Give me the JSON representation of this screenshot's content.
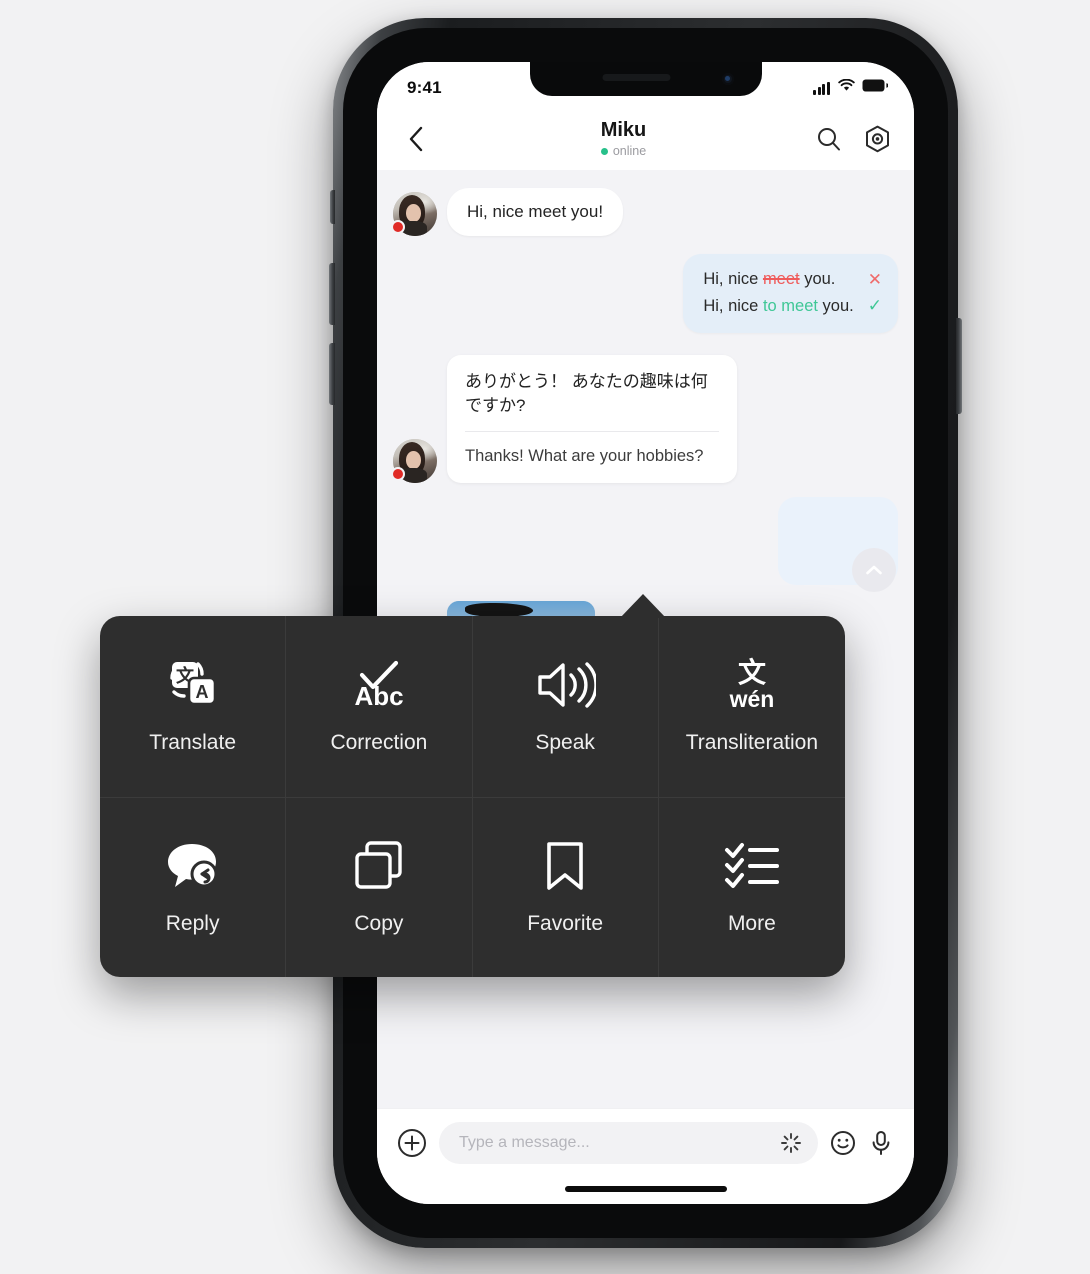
{
  "status_bar": {
    "time": "9:41",
    "signal_icon": "cellular-bars-icon",
    "wifi_icon": "wifi-icon",
    "battery_icon": "battery-full-icon"
  },
  "nav": {
    "back_icon": "chevron-left-icon",
    "title": "Miku",
    "status": "online",
    "status_color": "#27c08a",
    "search_icon": "search-icon",
    "settings_icon": "hexagon-settings-icon"
  },
  "chat": {
    "messages": [
      {
        "id": "msg-greeting-incoming",
        "type": "incoming-text",
        "avatar": "contact-avatar",
        "text": "Hi, nice meet you!"
      },
      {
        "id": "msg-correction-outgoing",
        "type": "outgoing-correction",
        "original_prefix": "Hi, nice ",
        "original_strike": "meet",
        "original_suffix": " you.",
        "corrected_prefix": "Hi, nice ",
        "corrected_added": "to meet",
        "corrected_suffix": " you.",
        "reject_icon": "close-x-icon",
        "accept_icon": "check-icon",
        "strike_color": "#ef5b5b",
        "added_color": "#3fc796",
        "bubble_color": "#e4eef8"
      },
      {
        "id": "msg-japanese-incoming",
        "type": "incoming-translated",
        "avatar": "contact-avatar",
        "source_text": "ありがとう！ あなたの趣味は何ですか?",
        "translated_text": "Thanks! What are your hobbies?"
      },
      {
        "id": "msg-outgoing-hidden",
        "type": "outgoing-partial",
        "text": ""
      },
      {
        "id": "msg-photo-incoming",
        "type": "incoming-photo",
        "avatar": "contact-avatar",
        "photo_alt": "landscape-photo"
      }
    ],
    "scroll_top_icon": "chevron-up-icon"
  },
  "input_bar": {
    "add_icon": "plus-circle-icon",
    "placeholder": "Type a message...",
    "magic_icon": "sparkle-ai-icon",
    "emoji_icon": "smiley-face-icon",
    "mic_icon": "microphone-icon"
  },
  "context_menu": {
    "background": "#2e2e2e",
    "items": [
      {
        "id": "translate",
        "label": "Translate",
        "icon": "translate-icon"
      },
      {
        "id": "correction",
        "label": "Correction",
        "icon": "spellcheck-abc-icon"
      },
      {
        "id": "speak",
        "label": "Speak",
        "icon": "speaker-volume-icon"
      },
      {
        "id": "transliteration",
        "label": "Transliteration",
        "icon": "pinyin-wen-icon",
        "icon_text": "文",
        "icon_subtext": "wén"
      },
      {
        "id": "reply",
        "label": "Reply",
        "icon": "reply-bubble-icon"
      },
      {
        "id": "copy",
        "label": "Copy",
        "icon": "copy-icon"
      },
      {
        "id": "favorite",
        "label": "Favorite",
        "icon": "bookmark-icon"
      },
      {
        "id": "more",
        "label": "More",
        "icon": "checklist-icon"
      }
    ]
  }
}
